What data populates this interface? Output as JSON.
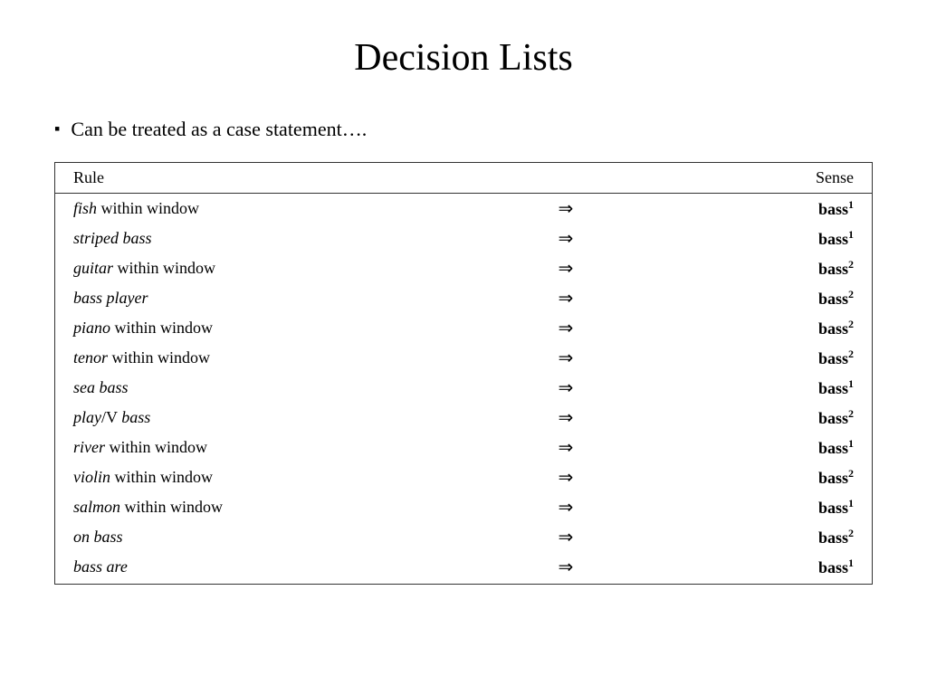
{
  "title": "Decision Lists",
  "bullet": {
    "marker": "▪",
    "text": "Can be treated as a case statement…."
  },
  "table": {
    "headers": {
      "rule": "Rule",
      "arrow": "",
      "sense": "Sense"
    },
    "rows": [
      {
        "rule_html": "<span class='italic-word'>fish</span> within window",
        "arrow": "⇒",
        "sense": "bass",
        "sense_sup": "1"
      },
      {
        "rule_html": "<span class='italic-word'>striped bass</span>",
        "arrow": "⇒",
        "sense": "bass",
        "sense_sup": "1"
      },
      {
        "rule_html": "<span class='italic-word'>guitar</span> within window",
        "arrow": "⇒",
        "sense": "bass",
        "sense_sup": "2"
      },
      {
        "rule_html": "<span class='italic-word'>bass player</span>",
        "arrow": "⇒",
        "sense": "bass",
        "sense_sup": "2"
      },
      {
        "rule_html": "<span class='italic-word'>piano</span> within window",
        "arrow": "⇒",
        "sense": "bass",
        "sense_sup": "2"
      },
      {
        "rule_html": "<span class='italic-word'>tenor</span> within window",
        "arrow": "⇒",
        "sense": "bass",
        "sense_sup": "2"
      },
      {
        "rule_html": "<span class='italic-word'>sea bass</span>",
        "arrow": "⇒",
        "sense": "bass",
        "sense_sup": "1"
      },
      {
        "rule_html": "<span class='italic-word'>play</span>/V <span class='italic-word'>bass</span>",
        "arrow": "⇒",
        "sense": "bass",
        "sense_sup": "2"
      },
      {
        "rule_html": "<span class='italic-word'>river</span> within window",
        "arrow": "⇒",
        "sense": "bass",
        "sense_sup": "1"
      },
      {
        "rule_html": "<span class='italic-word'>violin</span> within window",
        "arrow": "⇒",
        "sense": "bass",
        "sense_sup": "2"
      },
      {
        "rule_html": "<span class='italic-word'>salmon</span> within window",
        "arrow": "⇒",
        "sense": "bass",
        "sense_sup": "1"
      },
      {
        "rule_html": "<span class='italic-word'>on bass</span>",
        "arrow": "⇒",
        "sense": "bass",
        "sense_sup": "2"
      },
      {
        "rule_html": "<span class='italic-word'>bass are</span>",
        "arrow": "⇒",
        "sense": "bass",
        "sense_sup": "1"
      }
    ]
  }
}
